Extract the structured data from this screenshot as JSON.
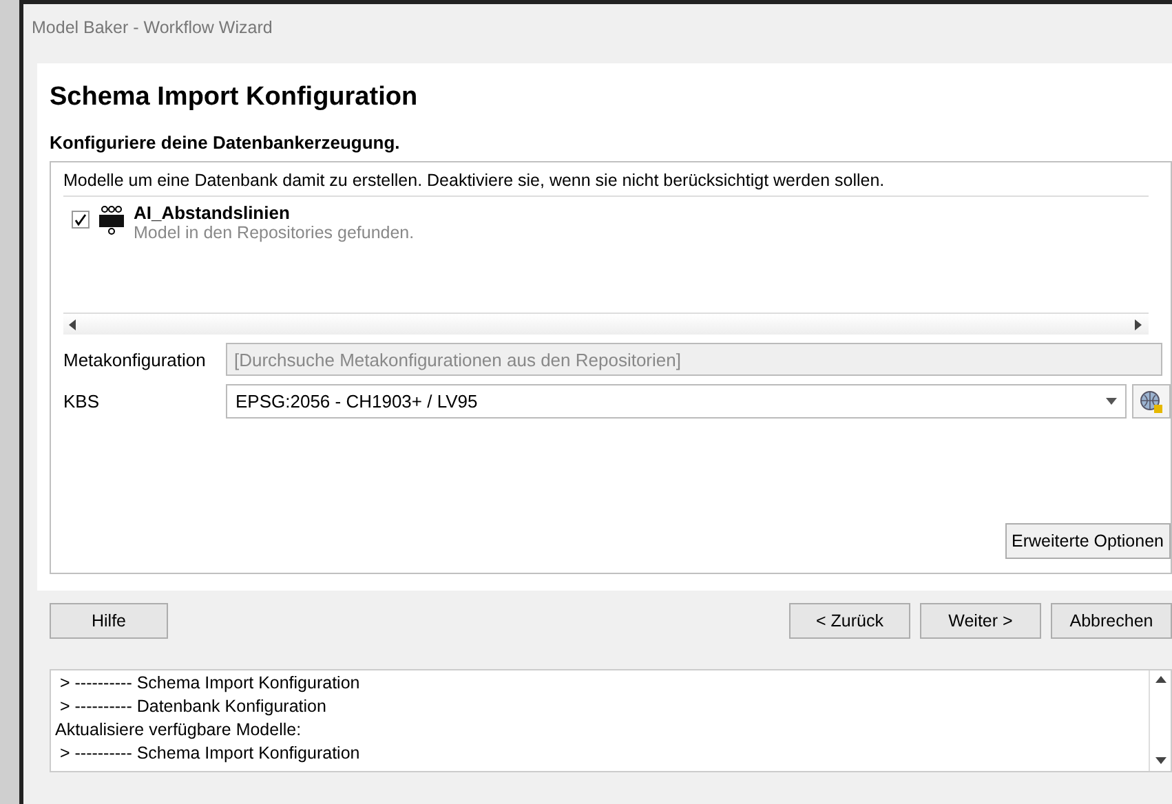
{
  "window": {
    "title": "Model Baker - Workflow Wizard"
  },
  "page": {
    "title": "Schema Import Konfiguration",
    "subtitle": "Konfiguriere deine Datenbankerzeugung."
  },
  "models": {
    "hint": "Modelle um eine Datenbank damit zu erstellen. Deaktiviere sie, wenn sie nicht berücksichtigt werden sollen.",
    "items": [
      {
        "name": "AI_Abstandslinien",
        "status": "Model in den Repositories gefunden.",
        "checked": true
      }
    ]
  },
  "metaconfig": {
    "label": "Metakonfiguration",
    "placeholder": "[Durchsuche Metakonfigurationen aus den Repositorien]",
    "disabled": true
  },
  "crs": {
    "label": "KBS",
    "value": "EPSG:2056 - CH1903+ / LV95"
  },
  "advanced_button": "Erweiterte Optionen",
  "buttons": [
    {
      "label": "Hilfe",
      "kind": "left"
    },
    {
      "label": "< Zurück",
      "kind": "right"
    },
    {
      "label": "Weiter >",
      "kind": "right"
    },
    {
      "label": "Abbrechen",
      "kind": "right"
    }
  ],
  "log": [
    " > ---------- Schema Import Konfiguration",
    " > ---------- Datenbank Konfiguration",
    "Aktualisiere verfügbare Modelle:",
    " > ---------- Schema Import Konfiguration"
  ]
}
